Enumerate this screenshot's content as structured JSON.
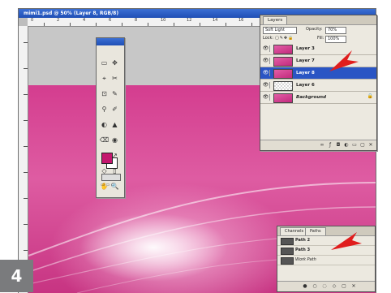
{
  "document": {
    "title": "mimi1.psd @ 50% (Layer 8, RGB/8)",
    "ruler_numbers": [
      "0",
      "2",
      "4",
      "6",
      "8",
      "10",
      "12",
      "14",
      "16",
      "18",
      "20",
      "22",
      "24"
    ],
    "foreground_color": "#c4166d",
    "background_color": "#ffffff"
  },
  "toolbox": {
    "tools": [
      "▭",
      "✥",
      "⌖",
      "✂",
      "⊡",
      "✎",
      "⚲",
      "✐",
      "◐",
      "▲",
      "⌫",
      "◉",
      "T",
      "↗",
      "◇",
      "▯",
      "✋",
      "🔍"
    ],
    "screen_icons": "▭ ▭ ▭"
  },
  "layers_panel": {
    "tabs": [
      "Layers"
    ],
    "blend_mode": "Soft Light",
    "opacity_label": "Opacity:",
    "opacity_value": "70%",
    "lock_label": "Lock:",
    "fill_label": "Fill:",
    "fill_value": "100%",
    "layers": [
      {
        "name": "Layer 3",
        "thumb": "pink",
        "active": false
      },
      {
        "name": "Layer 7",
        "thumb": "pink",
        "active": false
      },
      {
        "name": "Layer 8",
        "thumb": "pink",
        "active": true
      },
      {
        "name": "Layer 6",
        "thumb": "transparent",
        "active": false
      },
      {
        "name": "Background",
        "thumb": "pink",
        "active": false
      }
    ],
    "footer_icons": [
      "link-icon",
      "fx-icon",
      "mask-icon",
      "adjustment-icon",
      "folder-icon",
      "new-layer-icon",
      "trash-icon"
    ]
  },
  "paths_panel": {
    "tabs": [
      "Channels",
      "Paths"
    ],
    "paths": [
      {
        "name": "Path 2",
        "italic": false
      },
      {
        "name": "Path 3",
        "italic": false
      },
      {
        "name": "Work Path",
        "italic": true
      }
    ]
  },
  "step": {
    "number": "4",
    "color": "#7a7b7d"
  },
  "accent": {
    "arrow_color": "#e01d1d",
    "selection_color": "#2a55c4"
  }
}
